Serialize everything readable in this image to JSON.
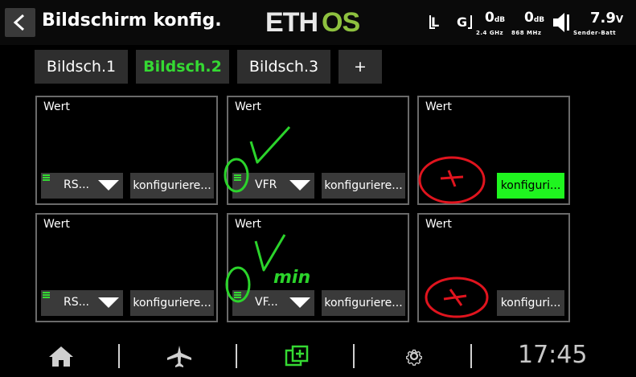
{
  "header": {
    "title": "Bildschirm konfig.",
    "logo": "ETHOS",
    "rx_label_l": "L",
    "rx_label_g": "G",
    "signal_1": {
      "value": "0",
      "unit": "dB",
      "sub": "2.4 GHz"
    },
    "signal_2": {
      "value": "0",
      "unit": "dB",
      "sub": "868 MHz"
    },
    "battery": {
      "value": "7.9",
      "unit": "V",
      "sub": "Sender-Batt"
    }
  },
  "tabs": [
    {
      "label": "Bildsch.1",
      "active": false
    },
    {
      "label": "Bildsch.2",
      "active": true
    },
    {
      "label": "Bildsch.3",
      "active": false
    },
    {
      "label": "+",
      "active": false
    }
  ],
  "widgets": [
    {
      "label": "Wert",
      "source": "RS...",
      "config": "konfiguriere..."
    },
    {
      "label": "Wert",
      "source": "VFR",
      "config": "konfiguriere..."
    },
    {
      "label": "Wert",
      "config": "konfiguri...",
      "config_highlighted": true
    },
    {
      "label": "Wert",
      "source": "RS...",
      "config": "konfiguriere..."
    },
    {
      "label": "Wert",
      "source": "VF...",
      "config": "konfiguriere..."
    },
    {
      "label": "Wert",
      "config": "konfiguri..."
    }
  ],
  "annotations": {
    "handwritten_text": "min"
  },
  "bottom_bar": {
    "icons": [
      "home-icon",
      "airplane-icon",
      "screens-icon",
      "gear-icon"
    ],
    "clock": "17:45"
  },
  "colors": {
    "accent_green": "#35d933",
    "highlight_green": "#1ff51f",
    "annotation_red": "#e0141e"
  }
}
